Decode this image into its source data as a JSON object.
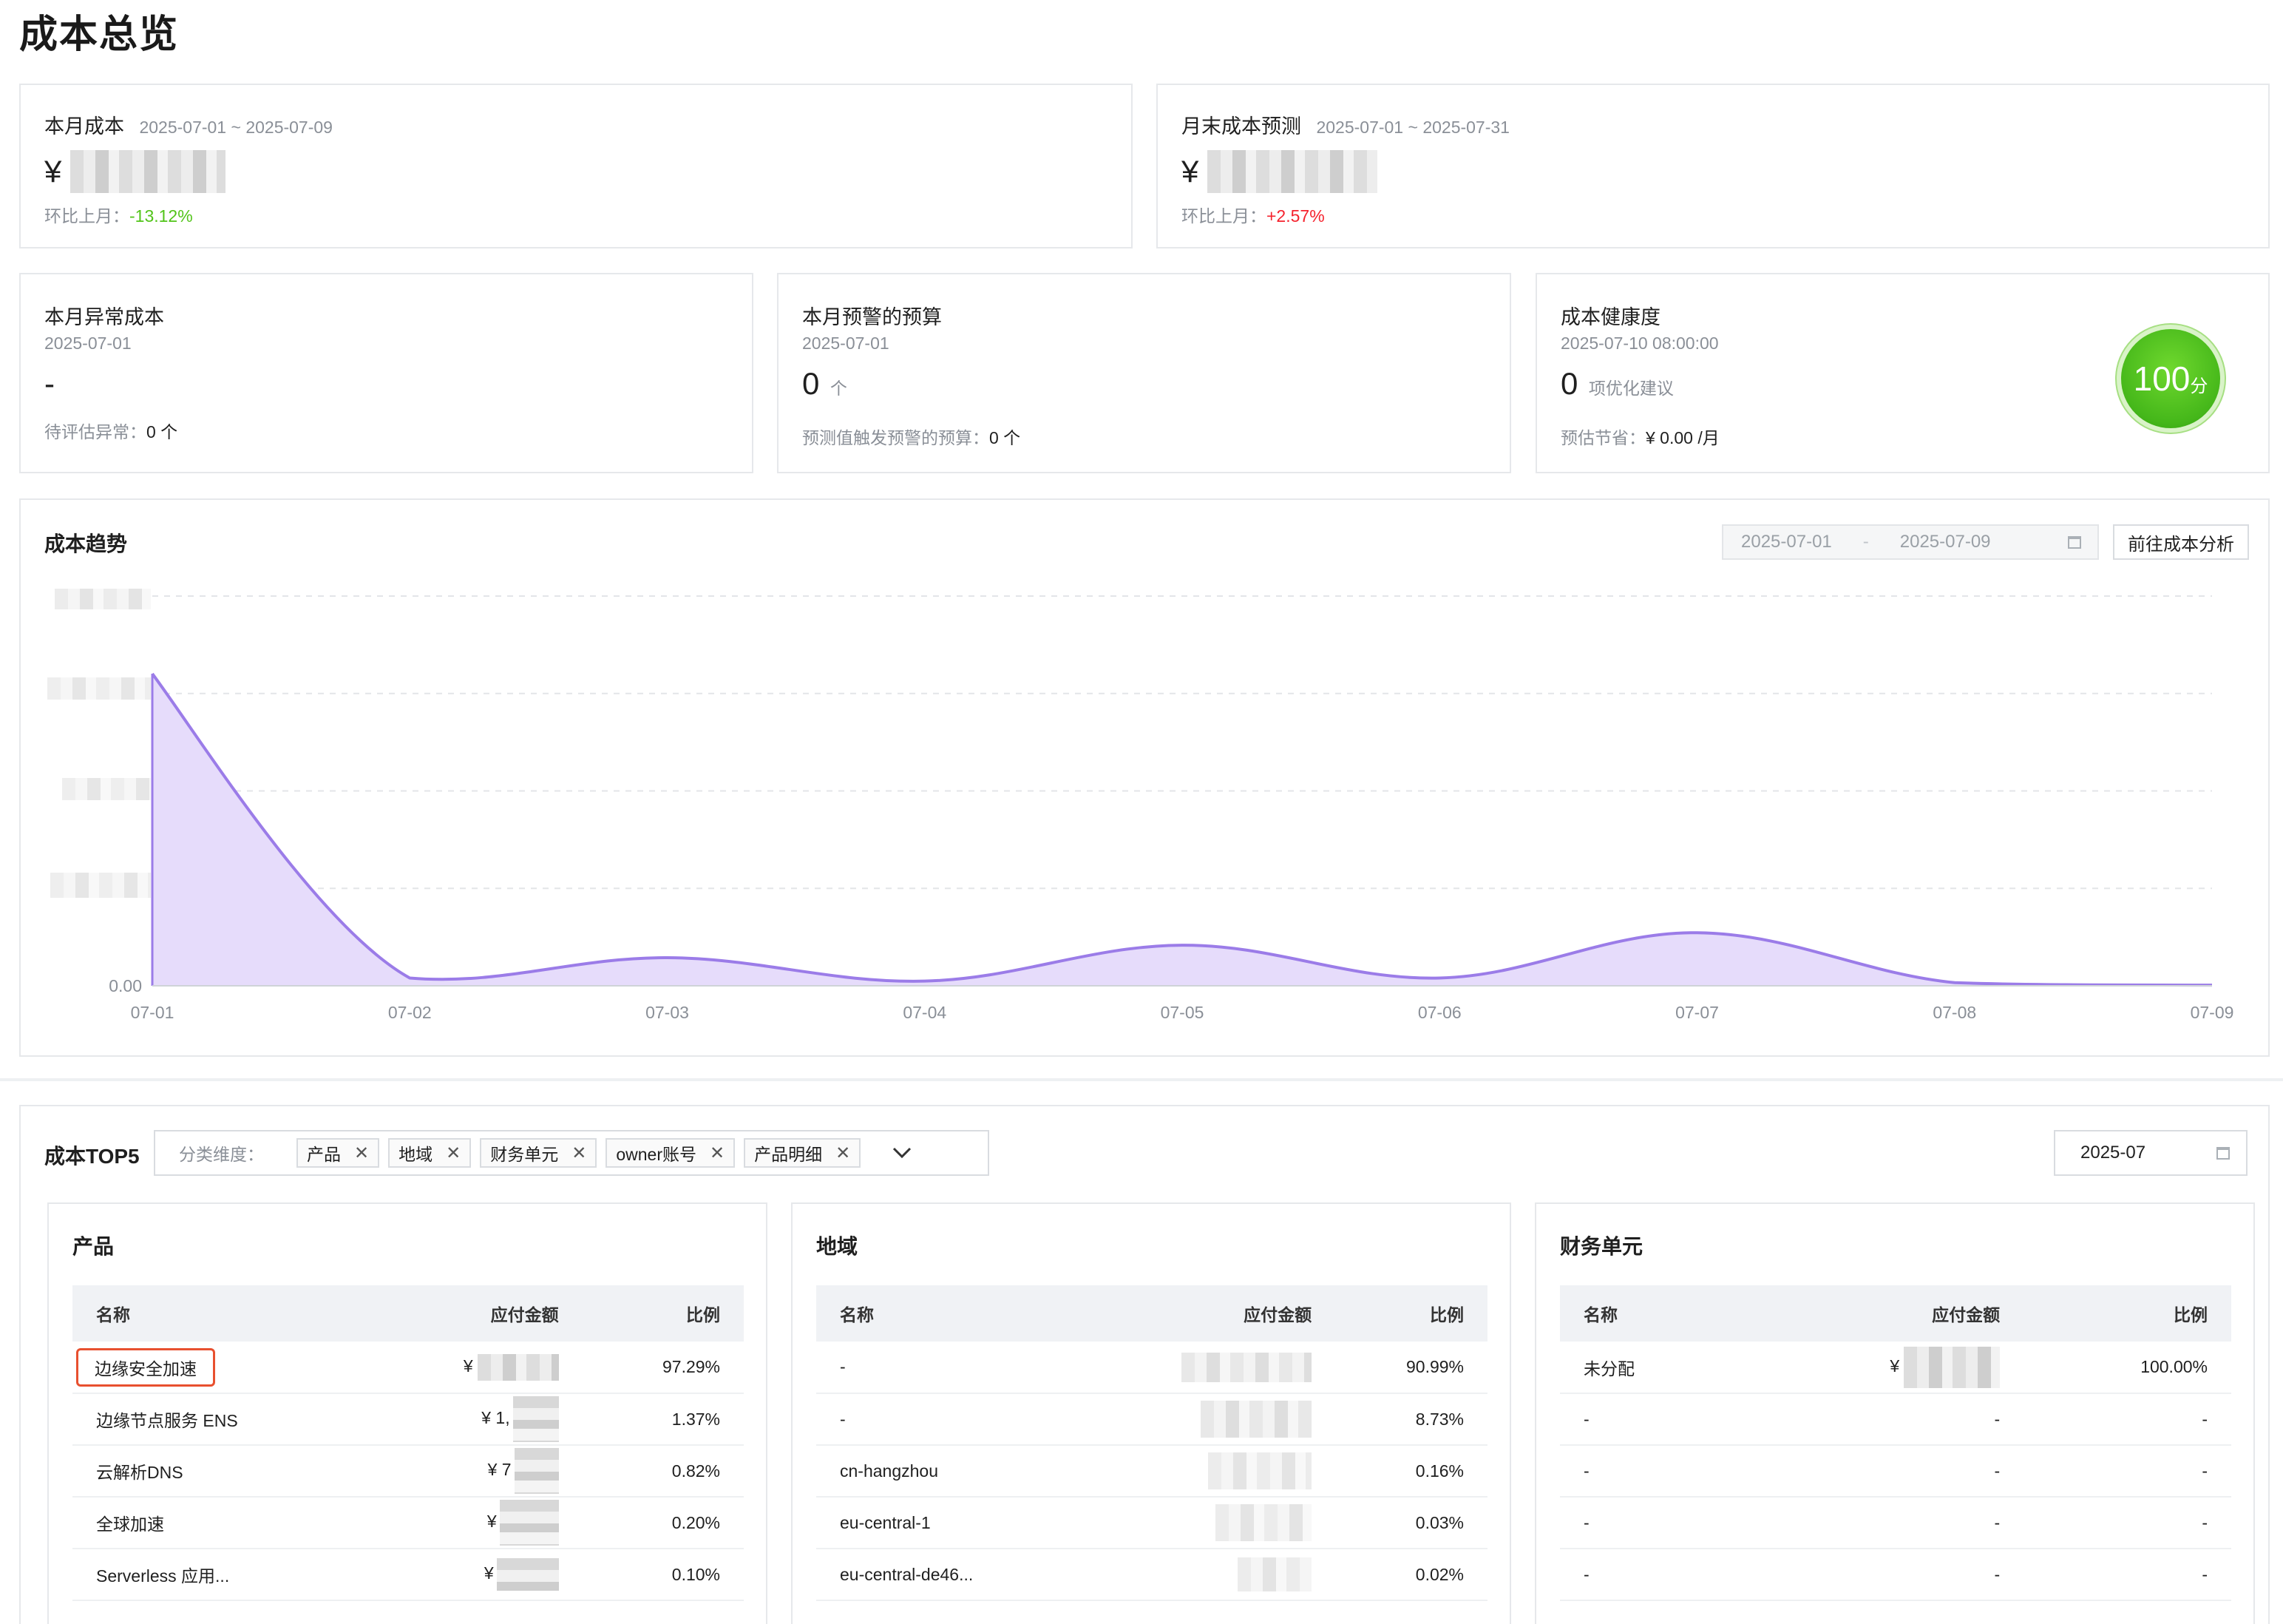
{
  "page_title": "成本总览",
  "month_cost": {
    "title": "本月成本",
    "range": "2025-07-01 ~ 2025-07-09",
    "currency": "¥",
    "mom_label": "环比上月：",
    "mom_value": "-13.12%"
  },
  "month_forecast": {
    "title": "月末成本预测",
    "range": "2025-07-01 ~ 2025-07-31",
    "currency": "¥",
    "mom_label": "环比上月：",
    "mom_value": "+2.57%"
  },
  "anomaly": {
    "title": "本月异常成本",
    "date": "2025-07-01",
    "value": "-",
    "pending_label": "待评估异常：",
    "pending_value": "0 个"
  },
  "budget": {
    "title": "本月预警的预算",
    "date": "2025-07-01",
    "value": "0",
    "unit": "个",
    "forecast_label": "预测值触发预警的预算：",
    "forecast_value": "0 个"
  },
  "health": {
    "title": "成本健康度",
    "datetime": "2025-07-10 08:00:00",
    "value": "0",
    "unit": "项优化建议",
    "saving_label": "预估节省：",
    "saving_value": "¥ 0.00 /月",
    "score": "100",
    "score_unit": "分"
  },
  "trend": {
    "title": "成本趋势",
    "start_date": "2025-07-01",
    "separator": "-",
    "end_date": "2025-07-09",
    "goto_button": "前往成本分析",
    "y_zero_label": "0.00"
  },
  "chart_data": {
    "type": "area",
    "x": [
      "07-01",
      "07-02",
      "07-03",
      "07-04",
      "07-05",
      "07-06",
      "07-07",
      "07-08",
      "07-09"
    ],
    "values": [
      100,
      2.5,
      9,
      1.5,
      13,
      2.5,
      17,
      1,
      0.2
    ],
    "y_tick_labels_visible": [
      "0.00"
    ],
    "grid": true,
    "color": "#9b7ce8",
    "fill": "#e6dcfb"
  },
  "top5": {
    "title": "成本TOP5",
    "filter_label": "分类维度：",
    "tags": [
      "产品",
      "地域",
      "财务单元",
      "owner账号",
      "产品明细"
    ],
    "month": "2025-07",
    "tables": [
      {
        "title": "产品",
        "headers": [
          "名称",
          "应付金额",
          "比例"
        ],
        "rows": [
          {
            "name": "边缘安全加速",
            "amount": "¥",
            "ratio": "97.29%"
          },
          {
            "name": "边缘节点服务 ENS",
            "amount": "¥ 1,",
            "ratio": "1.37%"
          },
          {
            "name": "云解析DNS",
            "amount": "¥ 7",
            "ratio": "0.82%"
          },
          {
            "name": "全球加速",
            "amount": "¥",
            "ratio": "0.20%"
          },
          {
            "name": "Serverless 应用...",
            "amount": "¥",
            "ratio": "0.10%"
          }
        ]
      },
      {
        "title": "地域",
        "headers": [
          "名称",
          "应付金额",
          "比例"
        ],
        "rows": [
          {
            "name": "-",
            "amount": "",
            "ratio": "90.99%"
          },
          {
            "name": "-",
            "amount": "",
            "ratio": "8.73%"
          },
          {
            "name": "cn-hangzhou",
            "amount": "",
            "ratio": "0.16%"
          },
          {
            "name": "eu-central-1",
            "amount": "",
            "ratio": "0.03%"
          },
          {
            "name": "eu-central-de46...",
            "amount": "",
            "ratio": "0.02%"
          }
        ]
      },
      {
        "title": "财务单元",
        "headers": [
          "名称",
          "应付金额",
          "比例"
        ],
        "rows": [
          {
            "name": "未分配",
            "amount": "¥",
            "ratio": "100.00%"
          },
          {
            "name": "-",
            "amount": "-",
            "ratio": "-"
          },
          {
            "name": "-",
            "amount": "-",
            "ratio": "-"
          },
          {
            "name": "-",
            "amount": "-",
            "ratio": "-"
          },
          {
            "name": "-",
            "amount": "-",
            "ratio": "-"
          }
        ]
      }
    ]
  }
}
